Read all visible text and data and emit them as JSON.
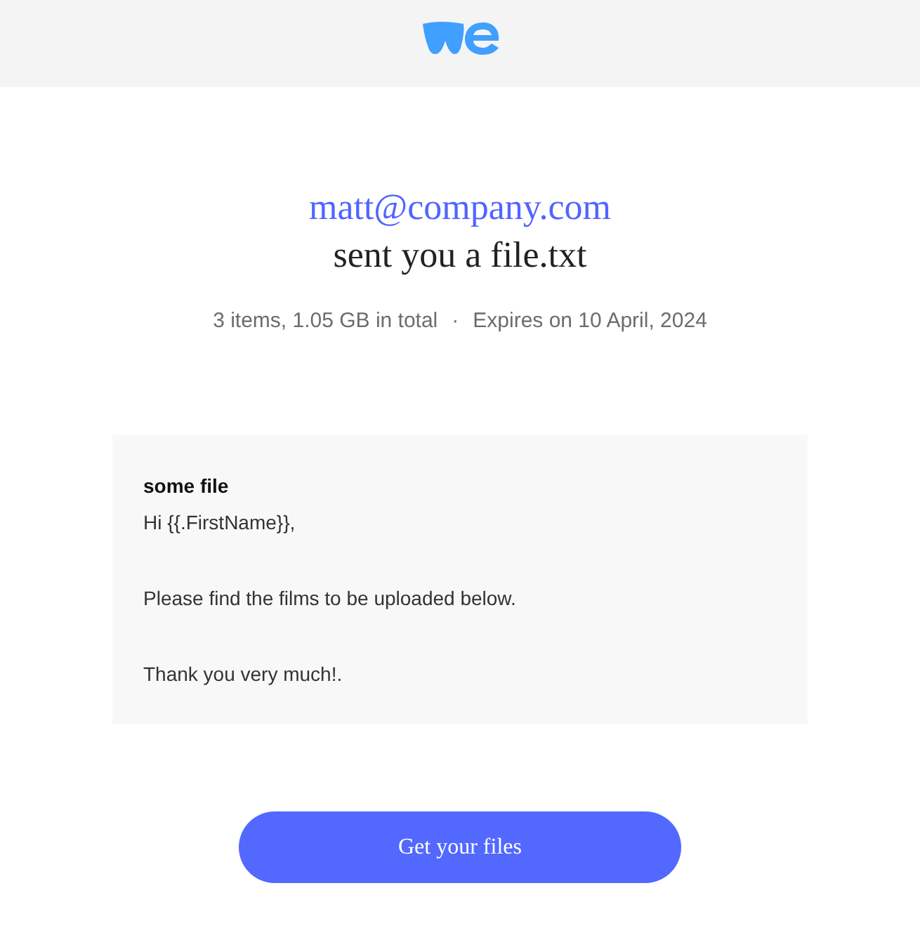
{
  "sender": "matt@company.com",
  "subject": "sent you a file.txt",
  "meta": {
    "items": "3 items, 1.05 GB in total",
    "separator": "·",
    "expiry": "Expires on 10 April, 2024"
  },
  "message": {
    "title": "some file",
    "paragraphs": [
      "Hi {{.FirstName}},",
      "Please find the films to be uploaded below.",
      "Thank you very much!."
    ]
  },
  "button": "Get your files"
}
